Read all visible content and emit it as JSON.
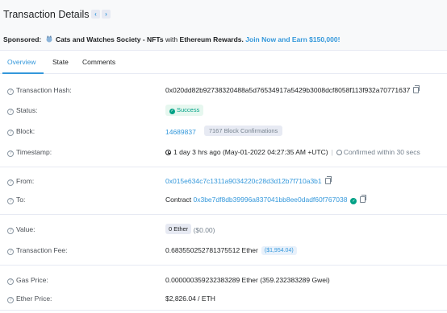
{
  "page": {
    "title": "Transaction Details",
    "prev_label": "‹",
    "next_label": "›"
  },
  "sponsor": {
    "label": "Sponsored:",
    "brand": "Cats and Watches Society - NFTs",
    "mid_text": "with",
    "reward": "Ethereum Rewards.",
    "cta": "Join Now and Earn $150,000!"
  },
  "tabs": [
    {
      "label": "Overview"
    },
    {
      "label": "State"
    },
    {
      "label": "Comments"
    }
  ],
  "fields": {
    "tx_hash": {
      "label": "Transaction Hash:",
      "value": "0x020dd82b92738320488a5d76534917a5429b3008dcf8058f113f932a70771637"
    },
    "status": {
      "label": "Status:",
      "value": "Success"
    },
    "block": {
      "label": "Block:",
      "value": "14689837",
      "confirmations": "7167 Block Confirmations"
    },
    "timestamp": {
      "label": "Timestamp:",
      "value": "1 day 3 hrs ago (May-01-2022 04:27:35 AM +UTC)",
      "confirmed": "Confirmed within 30 secs"
    },
    "from": {
      "label": "From:",
      "value": "0x015e634c7c1311a9034220c28d3d12b7f710a3b1"
    },
    "to": {
      "label": "To:",
      "prefix": "Contract",
      "value": "0x3be7df8db39996a837041bb8ee0dadf60f767038"
    },
    "value": {
      "label": "Value:",
      "amount": "0 Ether",
      "usd": "($0.00)"
    },
    "fee": {
      "label": "Transaction Fee:",
      "amount": "0.683550252781375512 Ether",
      "usd": "($1,954.04)"
    },
    "gas_price": {
      "label": "Gas Price:",
      "value": "0.000000359232383289 Ether (359.232383289 Gwei)"
    },
    "ether_price": {
      "label": "Ether Price:",
      "value": "$2,826.04 / ETH"
    }
  },
  "colors": {
    "accent": "#3498db",
    "success": "#00a186",
    "page_bg": "#f8f9fa"
  }
}
